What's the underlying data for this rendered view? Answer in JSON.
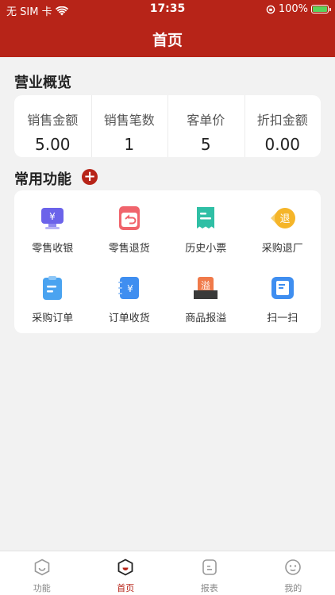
{
  "status_bar": {
    "carrier": "无 SIM 卡",
    "time": "17:35",
    "battery": "100%"
  },
  "header": {
    "title": "首页"
  },
  "overview": {
    "title": "营业概览",
    "items": [
      {
        "label": "销售金额",
        "value": "5.00"
      },
      {
        "label": "销售笔数",
        "value": "1"
      },
      {
        "label": "客单价",
        "value": "5"
      },
      {
        "label": "折扣金额",
        "value": "0.00"
      }
    ]
  },
  "functions": {
    "title": "常用功能",
    "add_symbol": "+",
    "items": [
      {
        "label": "零售收银",
        "icon": "cashier-icon",
        "color": "#6b63ea"
      },
      {
        "label": "零售退货",
        "icon": "retail-return-icon",
        "color": "#f0646c"
      },
      {
        "label": "历史小票",
        "icon": "receipt-icon",
        "color": "#2fbfa5"
      },
      {
        "label": "采购退厂",
        "icon": "purchase-return-icon",
        "color": "#f5b529"
      },
      {
        "label": "采购订单",
        "icon": "purchase-order-icon",
        "color": "#4aa3f0"
      },
      {
        "label": "订单收货",
        "icon": "order-receive-icon",
        "color": "#3f8ef0"
      },
      {
        "label": "商品报溢",
        "icon": "overflow-report-icon",
        "color": "#f07a4a"
      },
      {
        "label": "扫一扫",
        "icon": "scan-icon",
        "color": "#3f8ef0"
      }
    ],
    "icon_text": {
      "yen": "¥",
      "overflow": "溢",
      "return": "退"
    }
  },
  "tabbar": {
    "items": [
      {
        "label": "功能",
        "icon": "function-tab-icon"
      },
      {
        "label": "首页",
        "icon": "home-tab-icon",
        "active": true
      },
      {
        "label": "报表",
        "icon": "report-tab-icon"
      },
      {
        "label": "我的",
        "icon": "profile-tab-icon"
      }
    ],
    "accent": "#b72418"
  }
}
